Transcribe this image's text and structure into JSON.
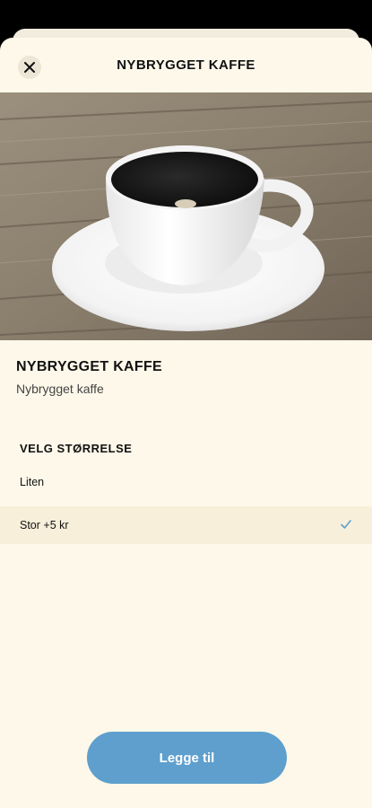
{
  "header": {
    "title": "NYBRYGGET KAFFE"
  },
  "product": {
    "name": "NYBRYGGET KAFFE",
    "description": "Nybrygget kaffe"
  },
  "size_section": {
    "title": "VELG STØRRELSE",
    "options": [
      {
        "label": "Liten",
        "selected": false
      },
      {
        "label": "Stor +5 kr",
        "selected": true
      }
    ]
  },
  "footer": {
    "add_label": "Legge til"
  },
  "colors": {
    "background": "#fdf8ea",
    "button": "#5e9fcd",
    "selected_row": "#f8efda",
    "check": "#5e9fcd"
  },
  "icons": {
    "close": "close-icon",
    "check": "checkmark-icon"
  }
}
